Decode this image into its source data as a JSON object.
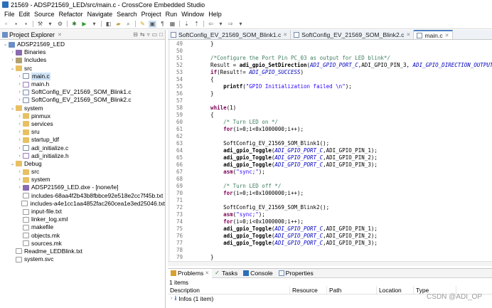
{
  "window": {
    "title": "21569 - ADSP21569_LED/src/main.c - CrossCore Embedded Studio"
  },
  "menu": [
    "File",
    "Edit",
    "Source",
    "Refactor",
    "Navigate",
    "Search",
    "Project",
    "Run",
    "Window",
    "Help"
  ],
  "explorer": {
    "tab_label": "Project Explorer",
    "tree": [
      {
        "depth": 0,
        "twisty": "v",
        "icon": "project",
        "label": "ADSP21569_LED"
      },
      {
        "depth": 1,
        "twisty": ">",
        "icon": "bin",
        "label": "Binaries"
      },
      {
        "depth": 1,
        "twisty": ">",
        "icon": "lib",
        "label": "Includes"
      },
      {
        "depth": 1,
        "twisty": "v",
        "icon": "folder",
        "label": "src"
      },
      {
        "depth": 2,
        "twisty": ">",
        "icon": "file-c",
        "label": "main.c",
        "selected": true
      },
      {
        "depth": 2,
        "twisty": ">",
        "icon": "file-h",
        "label": "main.h"
      },
      {
        "depth": 2,
        "twisty": ">",
        "icon": "file-c",
        "label": "SoftConfig_EV_21569_SOM_Blink1.c"
      },
      {
        "depth": 2,
        "twisty": ">",
        "icon": "file-c",
        "label": "SoftConfig_EV_21569_SOM_Blink2.c"
      },
      {
        "depth": 1,
        "twisty": "v",
        "icon": "folder",
        "label": "system"
      },
      {
        "depth": 2,
        "twisty": ">",
        "icon": "folder",
        "label": "pinmux"
      },
      {
        "depth": 2,
        "twisty": ">",
        "icon": "folder",
        "label": "services"
      },
      {
        "depth": 2,
        "twisty": ">",
        "icon": "folder",
        "label": "sru"
      },
      {
        "depth": 2,
        "twisty": ">",
        "icon": "folder",
        "label": "startup_ldf"
      },
      {
        "depth": 2,
        "twisty": ">",
        "icon": "file-c",
        "label": "adi_initialize.c"
      },
      {
        "depth": 2,
        "twisty": ">",
        "icon": "file-h",
        "label": "adi_initialize.h"
      },
      {
        "depth": 1,
        "twisty": "v",
        "icon": "folder",
        "label": "Debug"
      },
      {
        "depth": 2,
        "twisty": ">",
        "icon": "folder",
        "label": "src"
      },
      {
        "depth": 2,
        "twisty": ">",
        "icon": "folder",
        "label": "system"
      },
      {
        "depth": 2,
        "twisty": ">",
        "icon": "bin",
        "label": "ADSP21569_LED.dxe - [none/le]"
      },
      {
        "depth": 2,
        "twisty": "",
        "icon": "file",
        "label": "includes-68aa4f2b43b8fbbce92e518e2cc7f45b.txt"
      },
      {
        "depth": 2,
        "twisty": "",
        "icon": "file",
        "label": "includes-a4e1cc1aa4852fac260cea1e3ed25046.txt"
      },
      {
        "depth": 2,
        "twisty": "",
        "icon": "file",
        "label": "input-file.txt"
      },
      {
        "depth": 2,
        "twisty": "",
        "icon": "file",
        "label": "linker_log.xml"
      },
      {
        "depth": 2,
        "twisty": "",
        "icon": "file",
        "label": "makefile"
      },
      {
        "depth": 2,
        "twisty": "",
        "icon": "file",
        "label": "objects.mk"
      },
      {
        "depth": 2,
        "twisty": "",
        "icon": "file",
        "label": "sources.mk"
      },
      {
        "depth": 1,
        "twisty": "",
        "icon": "file",
        "label": "Readme_LEDBlink.txt"
      },
      {
        "depth": 1,
        "twisty": "",
        "icon": "file",
        "label": "system.svc"
      }
    ]
  },
  "editor": {
    "tabs": [
      {
        "label": "SoftConfig_EV_21569_SOM_Blink1.c",
        "active": false
      },
      {
        "label": "SoftConfig_EV_21569_SOM_Blink2.c",
        "active": false
      },
      {
        "label": "main.c",
        "active": true
      }
    ],
    "lines": [
      {
        "n": "49",
        "t": [
          [
            "plain",
            "    }"
          ]
        ]
      },
      {
        "n": "50",
        "t": []
      },
      {
        "n": "51",
        "t": [
          [
            "cm",
            "    /*Configure the Port Pin PC_03 as output for LED blink*/"
          ]
        ]
      },
      {
        "n": "52",
        "t": [
          [
            "plain",
            "    Result = "
          ],
          [
            "fn",
            "adi_gpio_SetDirection"
          ],
          [
            "plain",
            "("
          ],
          [
            "mac",
            "ADI_GPIO_PORT_C"
          ],
          [
            "plain",
            ",ADI_GPIO_PIN_3, "
          ],
          [
            "mac",
            "ADI_GPIO_DIRECTION_OUTPUT"
          ],
          [
            "plain",
            ");"
          ]
        ]
      },
      {
        "n": "53",
        "t": [
          [
            "kw",
            "    if"
          ],
          [
            "plain",
            "(Result!= "
          ],
          [
            "mac",
            "ADI_GPIO_SUCCESS"
          ],
          [
            "plain",
            ")"
          ]
        ]
      },
      {
        "n": "54",
        "t": [
          [
            "plain",
            "    {"
          ]
        ]
      },
      {
        "n": "55",
        "t": [
          [
            "plain",
            "        "
          ],
          [
            "fn",
            "printf"
          ],
          [
            "plain",
            "("
          ],
          [
            "str",
            "\"GPIO Initialization failed \\n\""
          ],
          [
            "plain",
            ");"
          ]
        ]
      },
      {
        "n": "56",
        "t": [
          [
            "plain",
            "    }"
          ]
        ]
      },
      {
        "n": "57",
        "t": []
      },
      {
        "n": "58",
        "t": [
          [
            "kw",
            "    while"
          ],
          [
            "plain",
            "(1)"
          ]
        ]
      },
      {
        "n": "59",
        "t": [
          [
            "plain",
            "    {"
          ]
        ]
      },
      {
        "n": "60",
        "t": [
          [
            "cm",
            "        /* Turn LED on */"
          ]
        ]
      },
      {
        "n": "61",
        "t": [
          [
            "kw",
            "        for"
          ],
          [
            "plain",
            "(i=0;i<0x1000000;i++);"
          ]
        ]
      },
      {
        "n": "62",
        "t": []
      },
      {
        "n": "63",
        "t": [
          [
            "plain",
            "        SoftConfig_EV_21569_SOM_Blink1();"
          ]
        ]
      },
      {
        "n": "64",
        "t": [
          [
            "plain",
            "        "
          ],
          [
            "fn",
            "adi_gpio_Toggle"
          ],
          [
            "plain",
            "("
          ],
          [
            "mac",
            "ADI_GPIO_PORT_C"
          ],
          [
            "plain",
            ",ADI_GPIO_PIN_1);"
          ]
        ]
      },
      {
        "n": "65",
        "t": [
          [
            "plain",
            "        "
          ],
          [
            "fn",
            "adi_gpio_Toggle"
          ],
          [
            "plain",
            "("
          ],
          [
            "mac",
            "ADI_GPIO_PORT_C"
          ],
          [
            "plain",
            ",ADI_GPIO_PIN_2);"
          ]
        ]
      },
      {
        "n": "66",
        "t": [
          [
            "plain",
            "        "
          ],
          [
            "fn",
            "adi_gpio_Toggle"
          ],
          [
            "plain",
            "("
          ],
          [
            "mac",
            "ADI_GPIO_PORT_C"
          ],
          [
            "plain",
            ",ADI_GPIO_PIN_3);"
          ]
        ]
      },
      {
        "n": "67",
        "t": [
          [
            "kw",
            "        asm"
          ],
          [
            "plain",
            "("
          ],
          [
            "str",
            "\"sync;\""
          ],
          [
            "plain",
            ");"
          ]
        ]
      },
      {
        "n": "68",
        "t": []
      },
      {
        "n": "69",
        "t": [
          [
            "cm",
            "        /* Turn LED off */"
          ]
        ]
      },
      {
        "n": "70",
        "t": [
          [
            "kw",
            "        for"
          ],
          [
            "plain",
            "(i=0;i<0x1000000;i++);"
          ]
        ]
      },
      {
        "n": "71",
        "t": []
      },
      {
        "n": "72",
        "t": [
          [
            "plain",
            "        SoftConfig_EV_21569_SOM_Blink2();"
          ]
        ]
      },
      {
        "n": "73",
        "t": [
          [
            "kw",
            "        asm"
          ],
          [
            "plain",
            "("
          ],
          [
            "str",
            "\"sync;\""
          ],
          [
            "plain",
            ");"
          ]
        ]
      },
      {
        "n": "74",
        "t": [
          [
            "kw",
            "        for"
          ],
          [
            "plain",
            "(i=0;i<0x1000000;i++);"
          ]
        ]
      },
      {
        "n": "75",
        "t": [
          [
            "plain",
            "        "
          ],
          [
            "fn",
            "adi_gpio_Toggle"
          ],
          [
            "plain",
            "("
          ],
          [
            "mac",
            "ADI_GPIO_PORT_C"
          ],
          [
            "plain",
            ",ADI_GPIO_PIN_1);"
          ]
        ]
      },
      {
        "n": "76",
        "t": [
          [
            "plain",
            "        "
          ],
          [
            "fn",
            "adi_gpio_Toggle"
          ],
          [
            "plain",
            "("
          ],
          [
            "mac",
            "ADI_GPIO_PORT_C"
          ],
          [
            "plain",
            ",ADI_GPIO_PIN_2);"
          ]
        ]
      },
      {
        "n": "77",
        "t": [
          [
            "plain",
            "        "
          ],
          [
            "fn",
            "adi_gpio_Toggle"
          ],
          [
            "plain",
            "("
          ],
          [
            "mac",
            "ADI_GPIO_PORT_C"
          ],
          [
            "plain",
            ",ADI_GPIO_PIN_3);"
          ]
        ]
      },
      {
        "n": "78",
        "t": []
      },
      {
        "n": "79",
        "t": [
          [
            "plain",
            "    }"
          ]
        ]
      },
      {
        "n": "80",
        "t": []
      }
    ]
  },
  "problems": {
    "tabs": [
      "Problems",
      "Tasks",
      "Console",
      "Properties"
    ],
    "count": "1 items",
    "columns": [
      "Description",
      "Resource",
      "Path",
      "Location",
      "Type"
    ],
    "row": "Infos (1 item)"
  },
  "watermark": "CSDN @ADI_OP",
  "colors": {
    "accent": "#4a7fc0",
    "keyword": "#7f0055",
    "comment": "#3f7f5f",
    "string": "#2a00ff",
    "macro": "#0000c0"
  }
}
